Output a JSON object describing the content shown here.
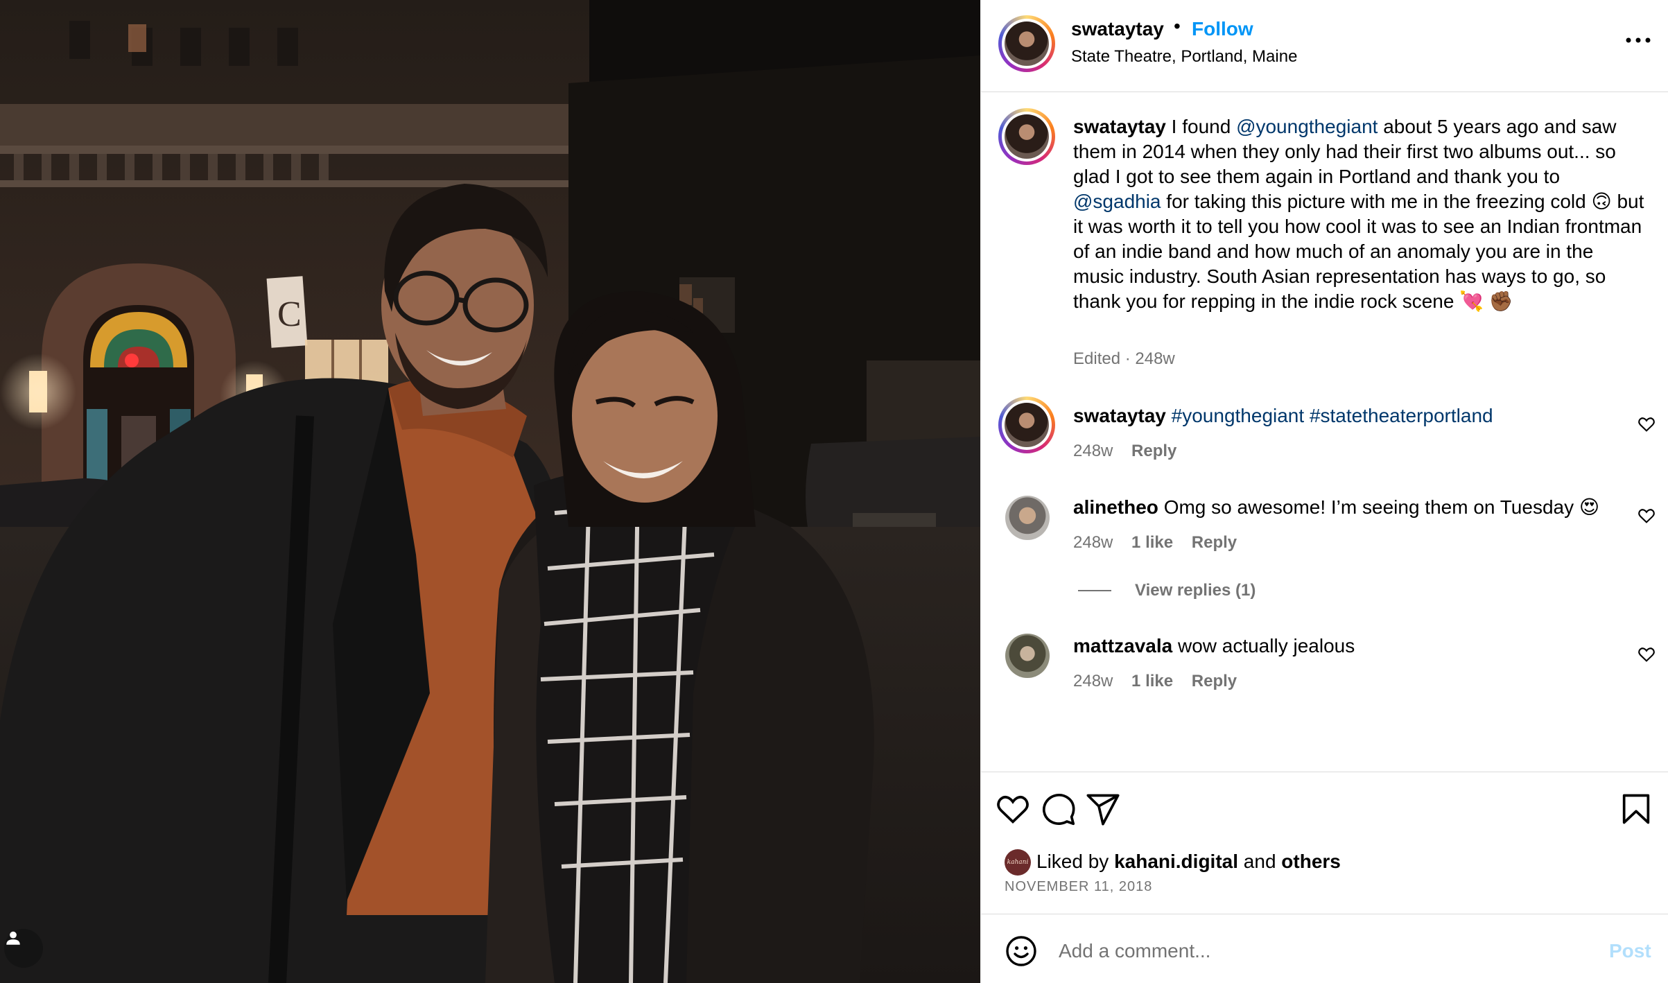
{
  "post": {
    "username": "swataytay",
    "follow_label": "Follow",
    "separator": "•",
    "location": "State Theatre, Portland, Maine"
  },
  "caption": {
    "username": "swataytay",
    "segments": [
      {
        "text": "I found ",
        "type": "text"
      },
      {
        "text": "@youngthegiant",
        "type": "mention"
      },
      {
        "text": " about 5 years ago and saw them in 2014 when they only had their first two albums out... so glad I got to see them again in Portland and thank you to ",
        "type": "text"
      },
      {
        "text": "@sgadhia",
        "type": "mention"
      },
      {
        "text": " for taking this picture with me in the freezing cold 🙃 but it was worth it to tell you how cool it was to see an Indian frontman of an indie band and how much of an anomaly you are in the music industry. South Asian representation has ways to go, so thank you for repping in the indie rock scene 💘 ✊🏾",
        "type": "text"
      }
    ],
    "meta": "Edited · 248w"
  },
  "comments": [
    {
      "username": "swataytay",
      "segments": [
        {
          "text": "#youngthegiant",
          "type": "hashtag"
        },
        {
          "text": " ",
          "type": "text"
        },
        {
          "text": "#statetheaterportland",
          "type": "hashtag"
        }
      ],
      "age": "248w",
      "likes": "",
      "reply_label": "Reply"
    },
    {
      "username": "alinetheo",
      "segments": [
        {
          "text": "Omg so awesome! I’m seeing them on Tuesday 😍",
          "type": "text"
        }
      ],
      "age": "248w",
      "likes": "1 like",
      "reply_label": "Reply",
      "view_replies": "View replies (1)"
    },
    {
      "username": "mattzavala",
      "segments": [
        {
          "text": "wow actually jealous",
          "type": "text"
        }
      ],
      "age": "248w",
      "likes": "1 like",
      "reply_label": "Reply"
    }
  ],
  "likes": {
    "prefix": "Liked by ",
    "user": "kahani.digital",
    "middle": " and ",
    "others": "others",
    "avatar_text": "kahani"
  },
  "date": "NOVEMBER 11, 2018",
  "add_comment": {
    "placeholder": "Add a comment...",
    "post_label": "Post"
  },
  "photo": {
    "sign_letter": "C"
  },
  "colors": {
    "link": "#00376b",
    "follow": "#0095f6",
    "muted": "#737373",
    "post_disabled": "#b2dffc"
  }
}
